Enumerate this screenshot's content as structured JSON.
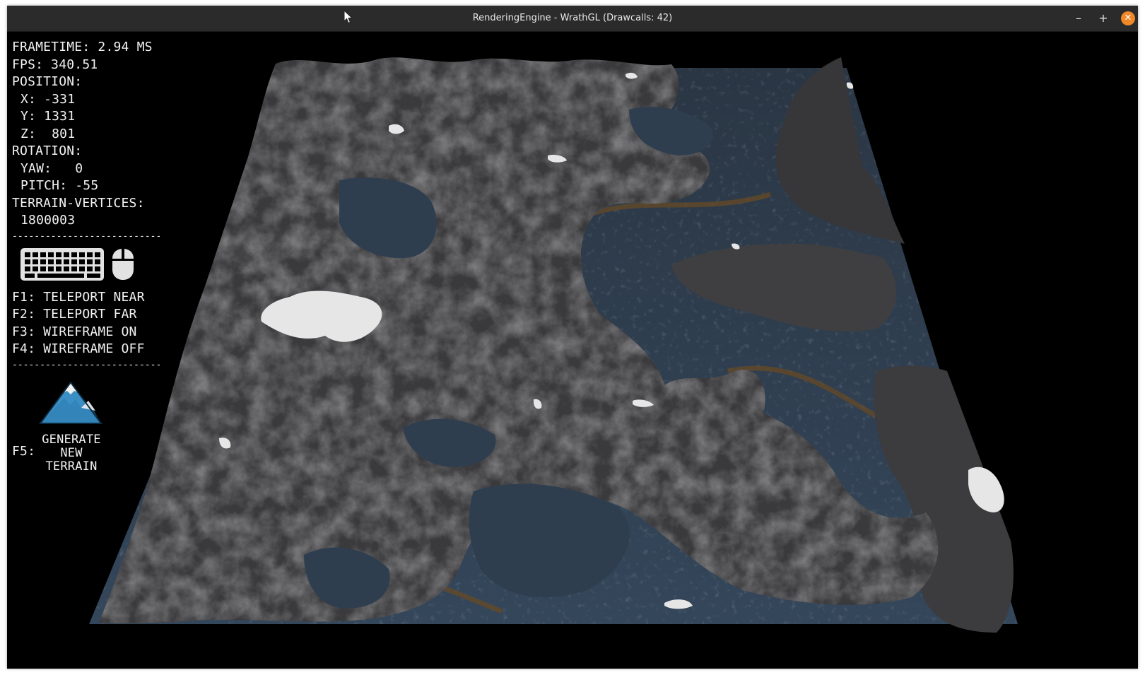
{
  "window": {
    "title": "RenderingEngine - WrathGL (Drawcalls: 42)",
    "minimize_glyph": "–",
    "maximize_glyph": "+",
    "close_glyph": "✕"
  },
  "hud": {
    "frametime": "FRAMETIME: 2.94 MS",
    "fps": "FPS: 340.51",
    "position_heading": "POSITION:",
    "pos_x": "X: -331",
    "pos_y": "Y: 1331",
    "pos_z": "Z:  801",
    "rotation_heading": "ROTATION:",
    "yaw": "YAW:   0",
    "pitch": "PITCH: -55",
    "terrain_vertices_heading": "TERRAIN-VERTICES:",
    "terrain_vertices": "1800003",
    "separator": "-------------------------------",
    "controls": [
      "F1: TELEPORT NEAR",
      "F2: TELEPORT FAR",
      "F3: WIREFRAME ON",
      "F4: WIREFRAME OFF"
    ],
    "generate_key": "F5:",
    "generate_label": "GENERATE\nNEW\nTERRAIN"
  },
  "icons": {
    "keyboard": "keyboard-icon",
    "mouse": "mouse-icon",
    "mountain": "mountain-icon",
    "cursor": "cursor-icon"
  },
  "colors": {
    "titlebar": "#2b2b2b",
    "close_button": "#f08828",
    "rock": "#3b3b3b",
    "water": "#2e3c4a",
    "mountain_icon_blue": "#3a8fc4"
  }
}
